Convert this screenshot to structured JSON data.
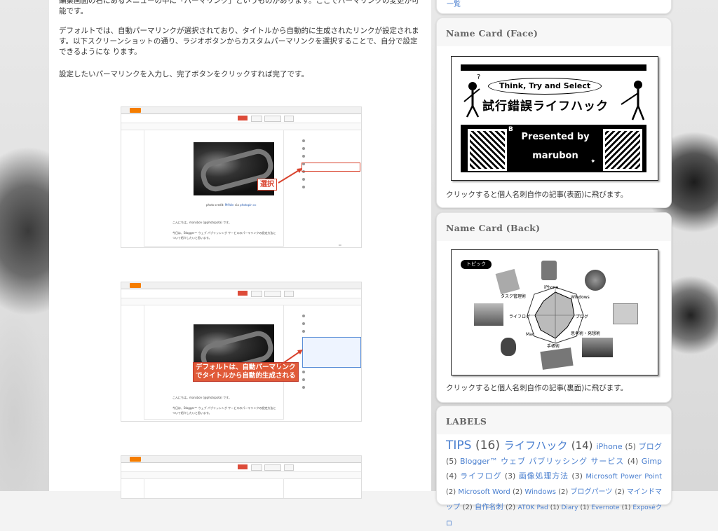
{
  "post": {
    "p0": "編集画面の右にあるメニューの中に「パーマリンク」というものがあります。ここでパーマリンクの変更が可能です。",
    "p1": "デフォルトでは、自動パーマリンクが選択されており、タイトルから自動的に生成されたリンクが設定されます。以下スクリーンショットの通り、ラジオボタンからカスタムパーマリンクを選択することで、自分で設定できるようにな ります。",
    "p2": "設定したいパーマリンクを入力し、完了ボタンをクリックすれば完了です。"
  },
  "screenshot1": {
    "callout": "選択",
    "caption_prefix": "photo credit: ",
    "caption_link1": "Mfrbln",
    "caption_mid": " via ",
    "caption_link2": "photopin cc",
    "text1": "こんにちは。marubon (@photopota) です。",
    "text2": "今日は、Blogger™ ウェブ パブリッシング サービスのパーマリンクの設定方法について紹介したいと思います。"
  },
  "screenshot2": {
    "callout_line1": "デフォルトは、自動パーマリンク",
    "callout_line2": "でタイトルから自動的生成される",
    "text1": "こんにちは。marubon (@photopota) です。",
    "text2": "今日は、Blogger™ ウェブ パブリッシング サービスのパーマリンクの設定方法について紹介したいと思います。"
  },
  "sidebar": {
    "face_title": "Name Card (Face)",
    "face_caption": "クリックすると個人名刺自作の記事(表面)に飛びます。",
    "face_card": {
      "slogan": "Think, Try and Select",
      "brand": "試行錯誤ライフハック",
      "presented": "Presented by",
      "name": "marubon"
    },
    "back_title": "Name Card (Back)",
    "back_caption": "クリックすると個人名刺自作の記事(裏面)に飛びます。",
    "back_card": {
      "topic_label": "トピック",
      "labels": [
        "iPhone",
        "Windows",
        "タスク管理術",
        "ブログ",
        "ライフログ",
        "思考術・発想術",
        "Mac",
        "手帳術"
      ]
    },
    "labels_title": "LABELS",
    "labels": [
      {
        "name": "TIPS",
        "count": "(16)",
        "size": 17
      },
      {
        "name": "ライフハック",
        "count": "(14)",
        "size": 15
      },
      {
        "name": "iPhone",
        "count": "(5)",
        "size": 11
      },
      {
        "name": "ブログ",
        "count": "(5)",
        "size": 11
      },
      {
        "name": "Blogger™ ウェブ パブリッシング サービス",
        "count": "(4)",
        "size": 11
      },
      {
        "name": "Gimp",
        "count": "(4)",
        "size": 11
      },
      {
        "name": "ライフログ",
        "count": "(3)",
        "size": 11
      },
      {
        "name": "画像処理方法",
        "count": "(3)",
        "size": 11
      },
      {
        "name": "Microsoft Power Point",
        "count": "(2)",
        "size": 10
      },
      {
        "name": "Microsoft Word",
        "count": "(2)",
        "size": 10
      },
      {
        "name": "Windows",
        "count": "(2)",
        "size": 10
      },
      {
        "name": "ブログパーツ",
        "count": "(2)",
        "size": 10
      },
      {
        "name": "マインドマップ",
        "count": "(2)",
        "size": 10
      },
      {
        "name": "自作名刺",
        "count": "(2)",
        "size": 10
      },
      {
        "name": "ATOK Pad",
        "count": "(1)",
        "size": 9
      },
      {
        "name": "Diary",
        "count": "(1)",
        "size": 9
      },
      {
        "name": "Evernote",
        "count": "(1)",
        "size": 9
      },
      {
        "name": "Exposéクロ",
        "count": "",
        "size": 9
      }
    ],
    "top_widget_link": "一覧"
  }
}
